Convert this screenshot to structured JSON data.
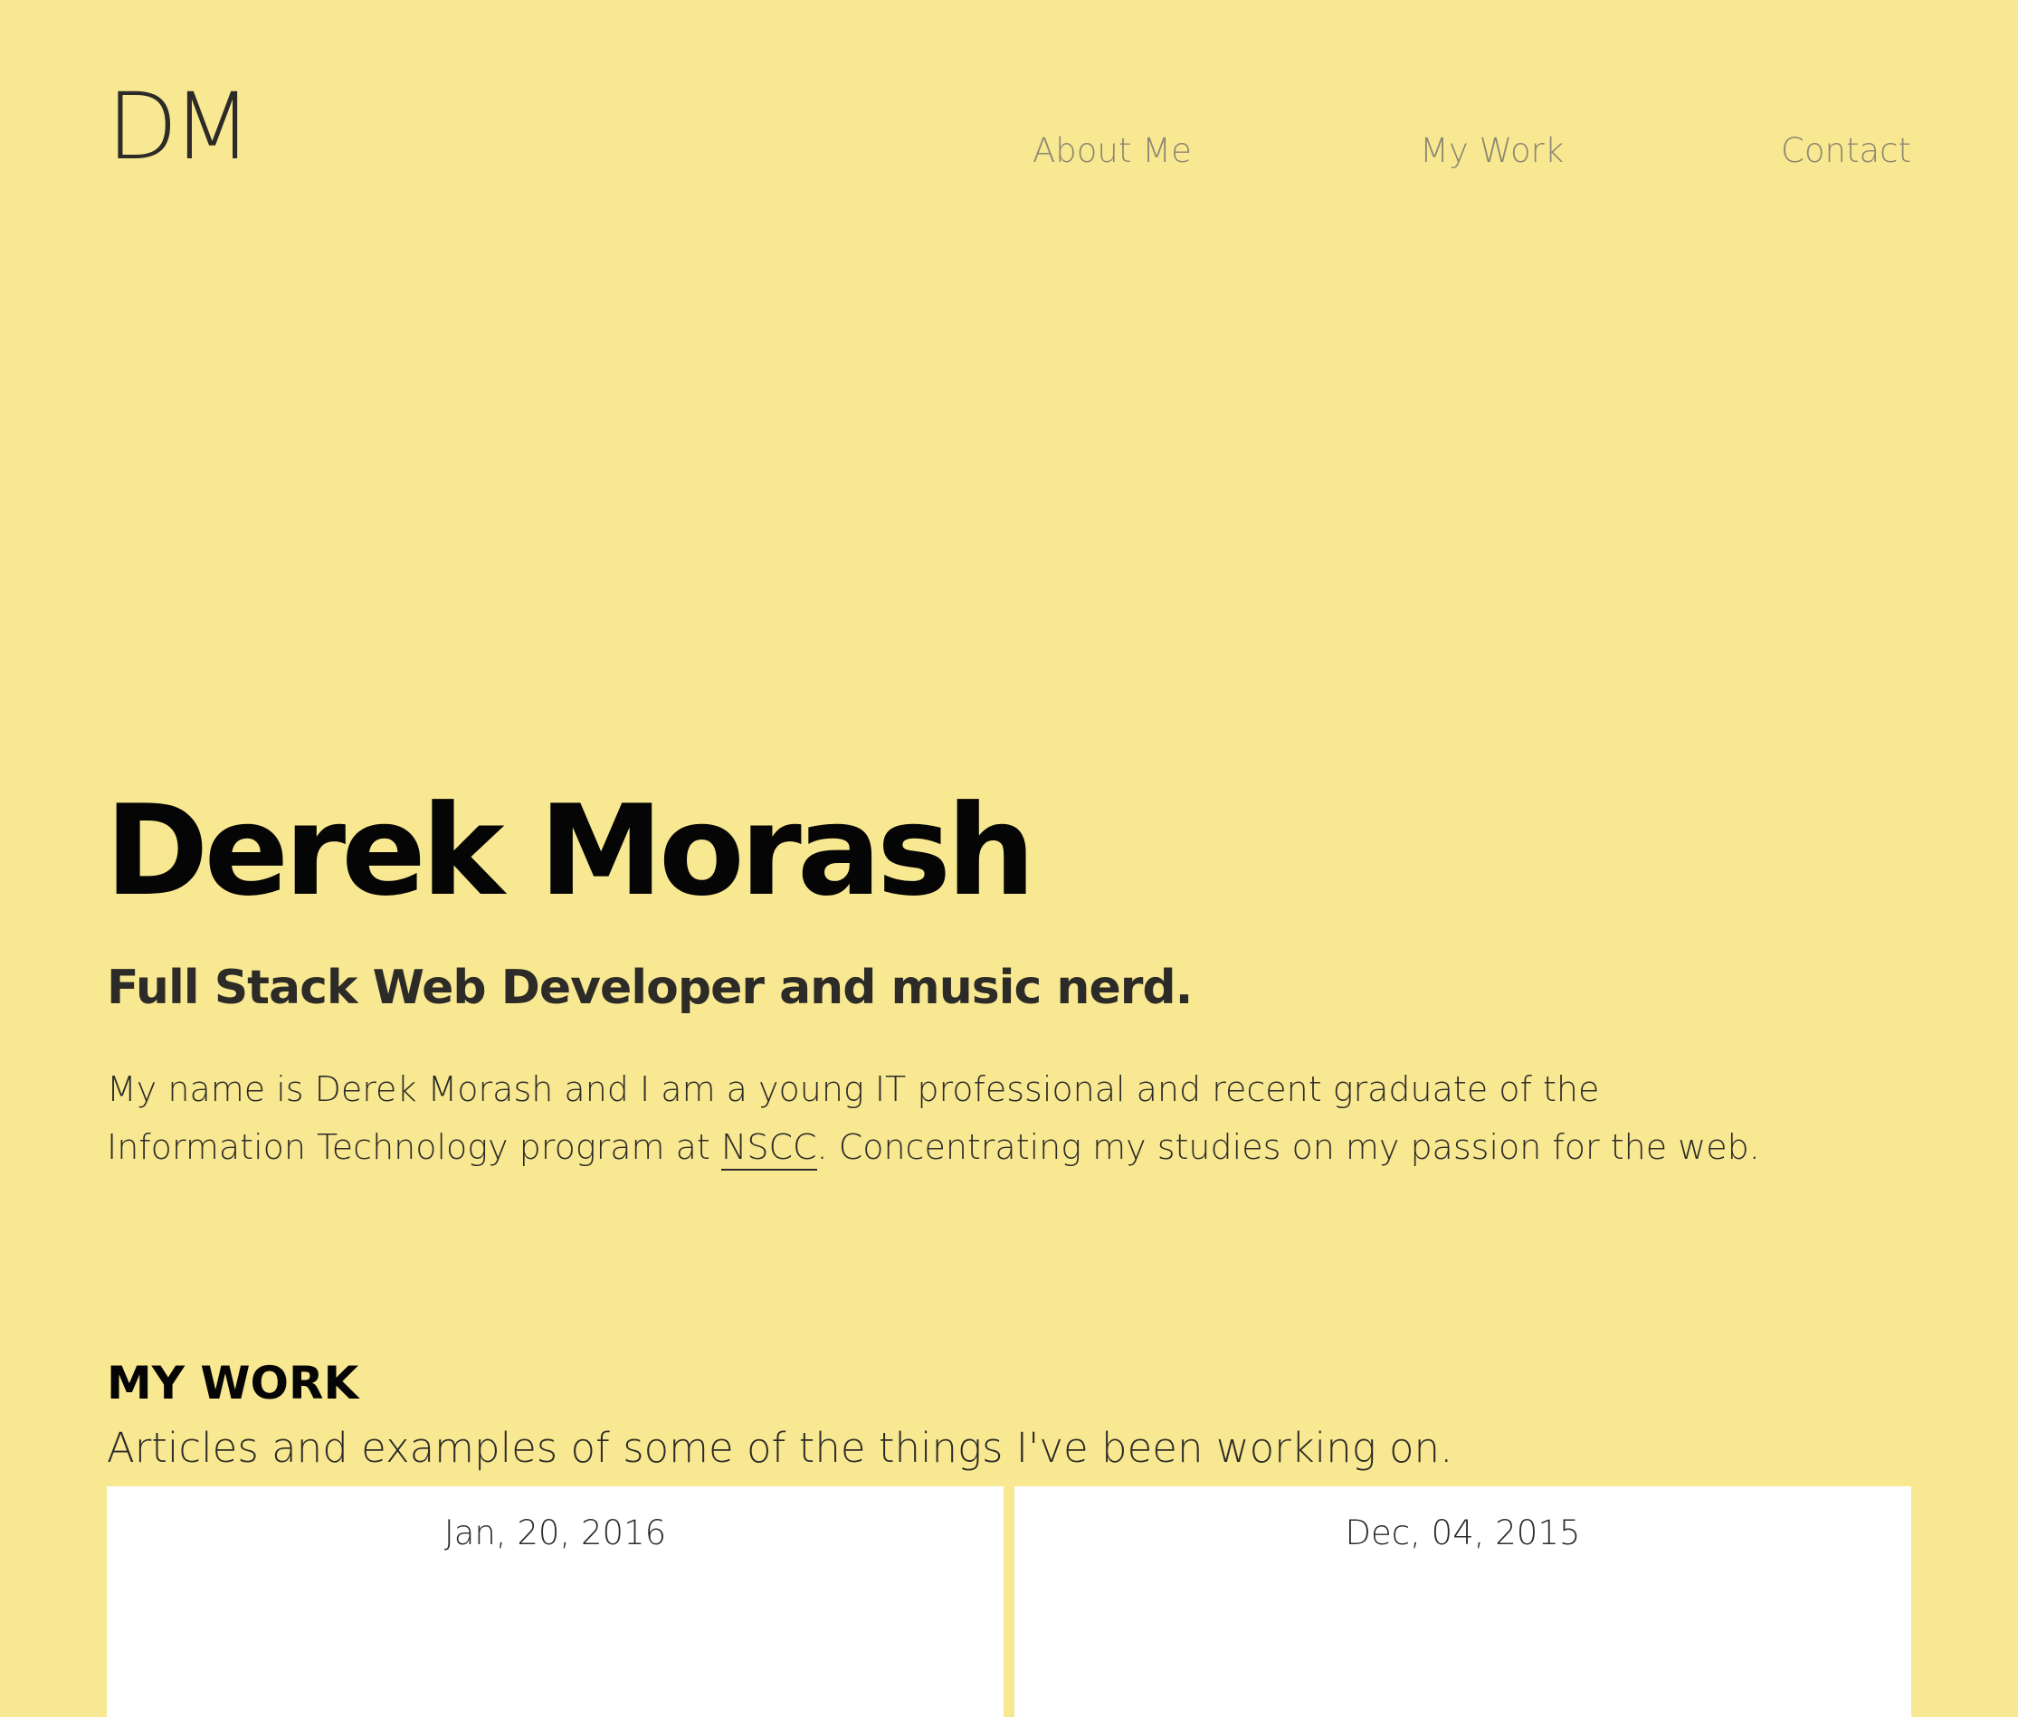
{
  "header": {
    "logo_text": "DM",
    "nav": {
      "about": "About Me",
      "work": "My Work",
      "contact": "Contact"
    }
  },
  "hero": {
    "title": "Derek Morash",
    "subtitle": "Full Stack Web Developer and music nerd.",
    "intro_before_link": "My name is Derek Morash and I am a young IT professional and recent graduate of the Information Technology program at ",
    "intro_link": "NSCC",
    "intro_after_link": ". Concentrating my studies on my passion for the web."
  },
  "work": {
    "heading": "MY WORK",
    "description": "Articles and examples of some of the things I've been working on.",
    "cards": [
      {
        "date": "Jan, 20, 2016"
      },
      {
        "date": "Dec, 04, 2015"
      }
    ]
  },
  "colors": {
    "background": "#f8e891",
    "text": "#2d2b27",
    "nav_text": "#8b8772",
    "card": "#ffffff"
  }
}
